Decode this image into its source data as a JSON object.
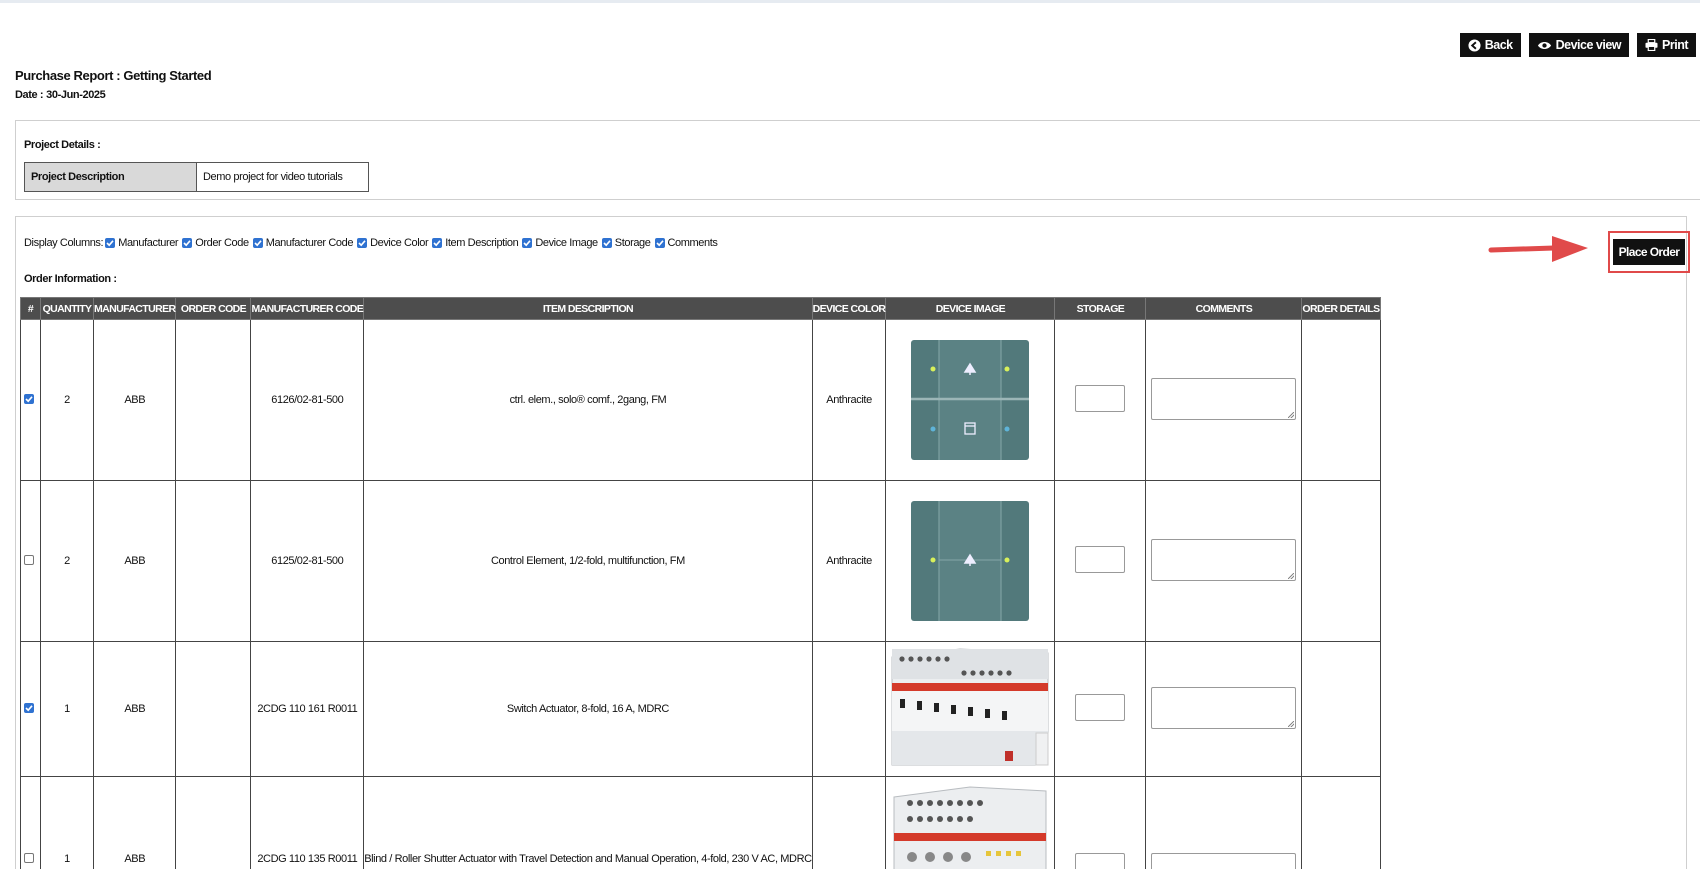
{
  "toolbar": {
    "back_label": "Back",
    "device_view_label": "Device view",
    "print_label": "Print"
  },
  "report": {
    "title": "Purchase Report : Getting Started",
    "date_label": "Date :",
    "date_value": "30-Jun-2025"
  },
  "project": {
    "section_label": "Project Details :",
    "description_key": "Project Description",
    "description_value": "Demo project for video tutorials"
  },
  "display_columns": {
    "label": "Display Columns:",
    "options": [
      {
        "label": "Manufacturer",
        "checked": true
      },
      {
        "label": "Order Code",
        "checked": true
      },
      {
        "label": "Manufacturer Code",
        "checked": true
      },
      {
        "label": "Device Color",
        "checked": true
      },
      {
        "label": "Item Description",
        "checked": true
      },
      {
        "label": "Device Image",
        "checked": true
      },
      {
        "label": "Storage",
        "checked": true
      },
      {
        "label": "Comments",
        "checked": true
      }
    ]
  },
  "place_order_label": "Place Order",
  "order": {
    "section_label": "Order Information :",
    "headers": [
      "#",
      "QUANTITY",
      "MANUFACTURER",
      "ORDER CODE",
      "MANUFACTURER CODE",
      "ITEM DESCRIPTION",
      "DEVICE COLOR",
      "DEVICE IMAGE",
      "STORAGE",
      "COMMENTS",
      "ORDER DETAILS"
    ],
    "rows": [
      {
        "checked": true,
        "quantity": "2",
        "manufacturer": "ABB",
        "order_code": "",
        "manufacturer_code": "6126/02-81-500",
        "description": "ctrl. elem., solo® comf., 2gang, FM",
        "color": "Anthracite",
        "image": "switch-2gang"
      },
      {
        "checked": false,
        "quantity": "2",
        "manufacturer": "ABB",
        "order_code": "",
        "manufacturer_code": "6125/02-81-500",
        "description": "Control Element, 1/2-fold, multifunction, FM",
        "color": "Anthracite",
        "image": "switch-1gang"
      },
      {
        "checked": true,
        "quantity": "1",
        "manufacturer": "ABB",
        "order_code": "",
        "manufacturer_code": "2CDG 110 161 R0011",
        "description": "Switch Actuator, 8-fold, 16 A, MDRC",
        "color": "",
        "image": "din-actuator"
      },
      {
        "checked": false,
        "quantity": "1",
        "manufacturer": "ABB",
        "order_code": "",
        "manufacturer_code": "2CDG 110 135 R0011",
        "description": "Blind / Roller Shutter Actuator with Travel Detection and Manual Operation, 4-fold, 230 V AC, MDRC",
        "color": "",
        "image": "din-blind-actuator"
      }
    ]
  },
  "colors": {
    "accent": "#2f72d1",
    "header_bg": "#4d4d4d",
    "highlight": "#e04a4a",
    "device_teal": "#52797b"
  }
}
